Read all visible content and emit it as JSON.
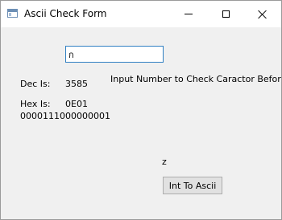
{
  "window": {
    "title": "Ascii Check Form",
    "icon": "window-app-icon",
    "controls": {
      "minimize_icon": "minimize-icon",
      "maximize_icon": "maximize-icon",
      "close_icon": "close-icon"
    }
  },
  "form": {
    "input_value": "ก",
    "instruction": "Input Number to Check Caractor Before Push",
    "dec_label": "Dec Is:",
    "dec_value": "3585",
    "hex_label": "Hex Is:",
    "hex_value": "0E01",
    "binary_value": "0000111000000001",
    "result_char": "z",
    "convert_button_label": "Int To Ascii"
  },
  "colors": {
    "focus_border": "#2f7fc2",
    "window_bg": "#f0f0f0",
    "titlebar_bg": "#ffffff",
    "button_bg": "#e1e1e1"
  }
}
